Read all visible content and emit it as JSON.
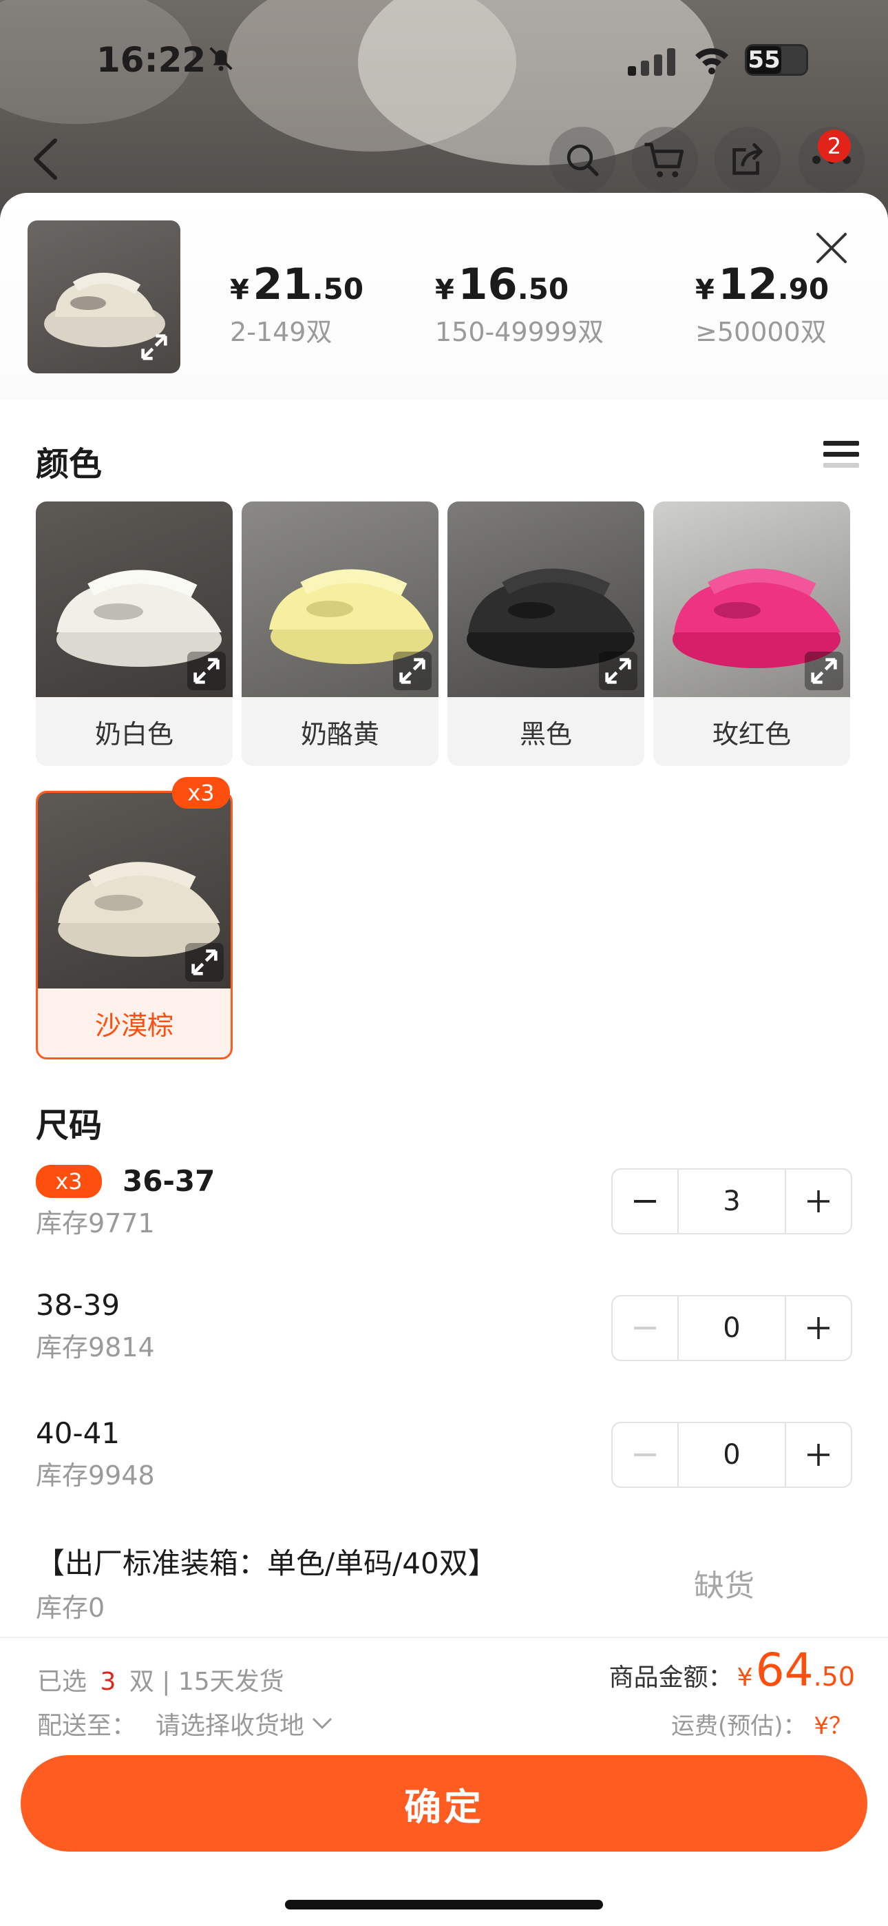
{
  "status_bar": {
    "time": "16:22",
    "battery": "55"
  },
  "nav": {
    "badge_count": "2"
  },
  "price_tiers": [
    {
      "yen": "¥",
      "integer": "21",
      "decimal": ".50",
      "range": "2-149双"
    },
    {
      "yen": "¥",
      "integer": "16",
      "decimal": ".50",
      "range": "150-49999双"
    },
    {
      "yen": "¥",
      "integer": "12",
      "decimal": ".90",
      "range": "≥50000双"
    }
  ],
  "color_section": {
    "title": "颜色",
    "options": [
      {
        "label": "奶白色",
        "shoe_color": "#efeee6"
      },
      {
        "label": "奶酪黄",
        "shoe_color": "#f2eb9a"
      },
      {
        "label": "黑色",
        "shoe_color": "#2a2a2a"
      },
      {
        "label": "玫红色",
        "shoe_color": "#ec2f79"
      },
      {
        "label": "沙漠棕",
        "shoe_color": "#e6dfce",
        "selected": true,
        "count": "x3"
      }
    ]
  },
  "size_section": {
    "title": "尺码",
    "rows": [
      {
        "name": "36-37",
        "stock": "库存9771",
        "qty": "3",
        "tag": "x3"
      },
      {
        "name": "38-39",
        "stock": "库存9814",
        "qty": "0"
      },
      {
        "name": "40-41",
        "stock": "库存9948",
        "qty": "0"
      },
      {
        "name": "【出厂标准装箱：单色/单码/40双】",
        "stock": "库存0",
        "status": "缺货"
      }
    ]
  },
  "summary": {
    "selected_prefix": "已选",
    "selected_count": "3",
    "selected_suffix": "双 | 15天发货",
    "ship_to_label": "配送至：",
    "ship_to_value": "请选择收货地",
    "amount_label": "商品金额：",
    "amount_yen": "¥",
    "amount_integer": "64",
    "amount_decimal": ".50",
    "freight_label": "运费(预估)：",
    "freight_value": "¥？"
  },
  "confirm_label": "确定",
  "colors": {
    "accent": "#ff5c21",
    "price_red": "#ff4f0f"
  }
}
